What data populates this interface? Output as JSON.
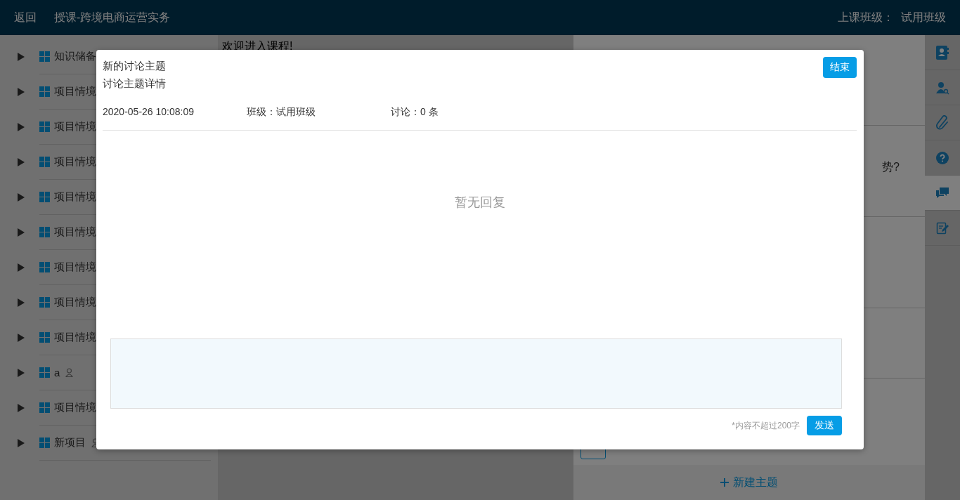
{
  "header": {
    "back": "返回",
    "course_title": "授课-跨境电商运营实务",
    "class_label": "上课班级：",
    "class_name": "试用班级"
  },
  "sidebar": {
    "items": [
      {
        "label": "知识储备"
      },
      {
        "label": "项目情境"
      },
      {
        "label": "项目情境"
      },
      {
        "label": "项目情境"
      },
      {
        "label": "项目情境"
      },
      {
        "label": "项目情境"
      },
      {
        "label": "项目情境"
      },
      {
        "label": "项目情境"
      },
      {
        "label": "项目情境"
      },
      {
        "label": "a",
        "person_icon": true
      },
      {
        "label": "项目情境"
      },
      {
        "label": "新项目",
        "person_icon": true
      }
    ]
  },
  "content": {
    "welcome": "欢迎进入课程!"
  },
  "right_panel": {
    "question_tail": "势?",
    "new_topic": "新建主题"
  },
  "rail": [
    {
      "kind": "contacts",
      "selected": false
    },
    {
      "kind": "user-search",
      "selected": false
    },
    {
      "kind": "attachment",
      "selected": false
    },
    {
      "kind": "help",
      "selected": false
    },
    {
      "kind": "chat",
      "selected": true
    },
    {
      "kind": "edit",
      "selected": false
    }
  ],
  "modal": {
    "title": "新的讨论主题",
    "subtitle": "讨论主题详情",
    "end_button": "结束",
    "time": "2020-05-26 10:08:09",
    "class_info": "班级：试用班级",
    "count_info": "讨论：0 条",
    "empty": "暂无回复",
    "hint": "*内容不超过200字",
    "send_button": "发送"
  }
}
